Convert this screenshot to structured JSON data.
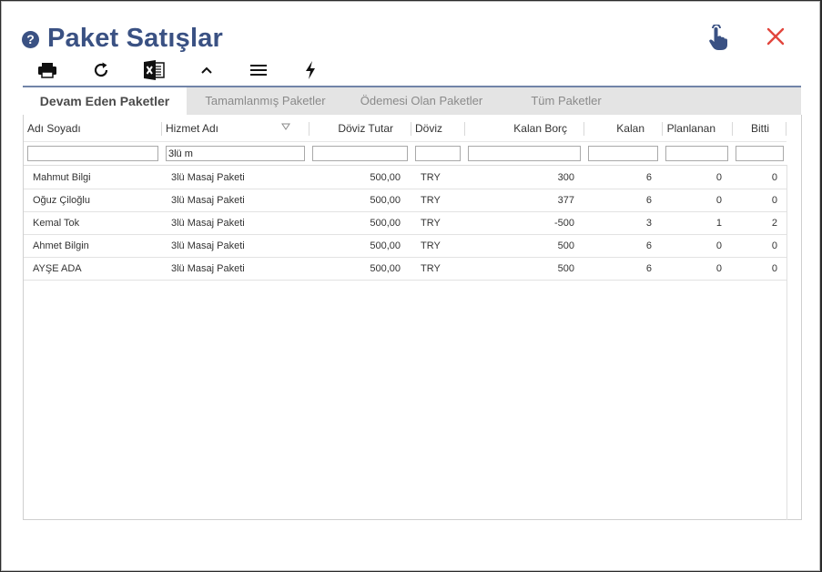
{
  "title": "Paket Satışlar",
  "toolbar": {
    "icons": [
      "print-icon",
      "refresh-icon",
      "excel-icon",
      "collapse-icon",
      "menu-icon",
      "lightning-icon"
    ]
  },
  "tabs": [
    {
      "label": "Devam Eden Paketler",
      "active": true
    },
    {
      "label": "Tamamlanmış Paketler",
      "active": false
    },
    {
      "label": "Ödemesi Olan Paketler",
      "active": false
    },
    {
      "label": "Tüm Paketler",
      "active": false
    }
  ],
  "columns": [
    "Adı Soyadı",
    "Hizmet Adı",
    "Döviz Tutar",
    "Döviz",
    "Kalan Borç",
    "Kalan",
    "Planlanan",
    "Bitti"
  ],
  "filters": {
    "hizmet": "3lü m"
  },
  "rows": [
    {
      "name": "Mahmut Bilgi",
      "service": "3lü Masaj Paketi",
      "amount": "500,00",
      "currency": "TRY",
      "debt": "300",
      "remaining": "6",
      "planned": "0",
      "done": "0"
    },
    {
      "name": "Oğuz Çiloğlu",
      "service": "3lü Masaj Paketi",
      "amount": "500,00",
      "currency": "TRY",
      "debt": "377",
      "remaining": "6",
      "planned": "0",
      "done": "0"
    },
    {
      "name": "Kemal Tok",
      "service": "3lü Masaj Paketi",
      "amount": "500,00",
      "currency": "TRY",
      "debt": "-500",
      "remaining": "3",
      "planned": "1",
      "done": "2"
    },
    {
      "name": "Ahmet Bilgin",
      "service": "3lü Masaj Paketi",
      "amount": "500,00",
      "currency": "TRY",
      "debt": "500",
      "remaining": "6",
      "planned": "0",
      "done": "0"
    },
    {
      "name": "AYŞE ADA",
      "service": "3lü Masaj Paketi",
      "amount": "500,00",
      "currency": "TRY",
      "debt": "500",
      "remaining": "6",
      "planned": "0",
      "done": "0"
    }
  ],
  "colors": {
    "title": "#3a5183",
    "close": "#e2453c",
    "tab_bar": "#e4e4e4"
  }
}
